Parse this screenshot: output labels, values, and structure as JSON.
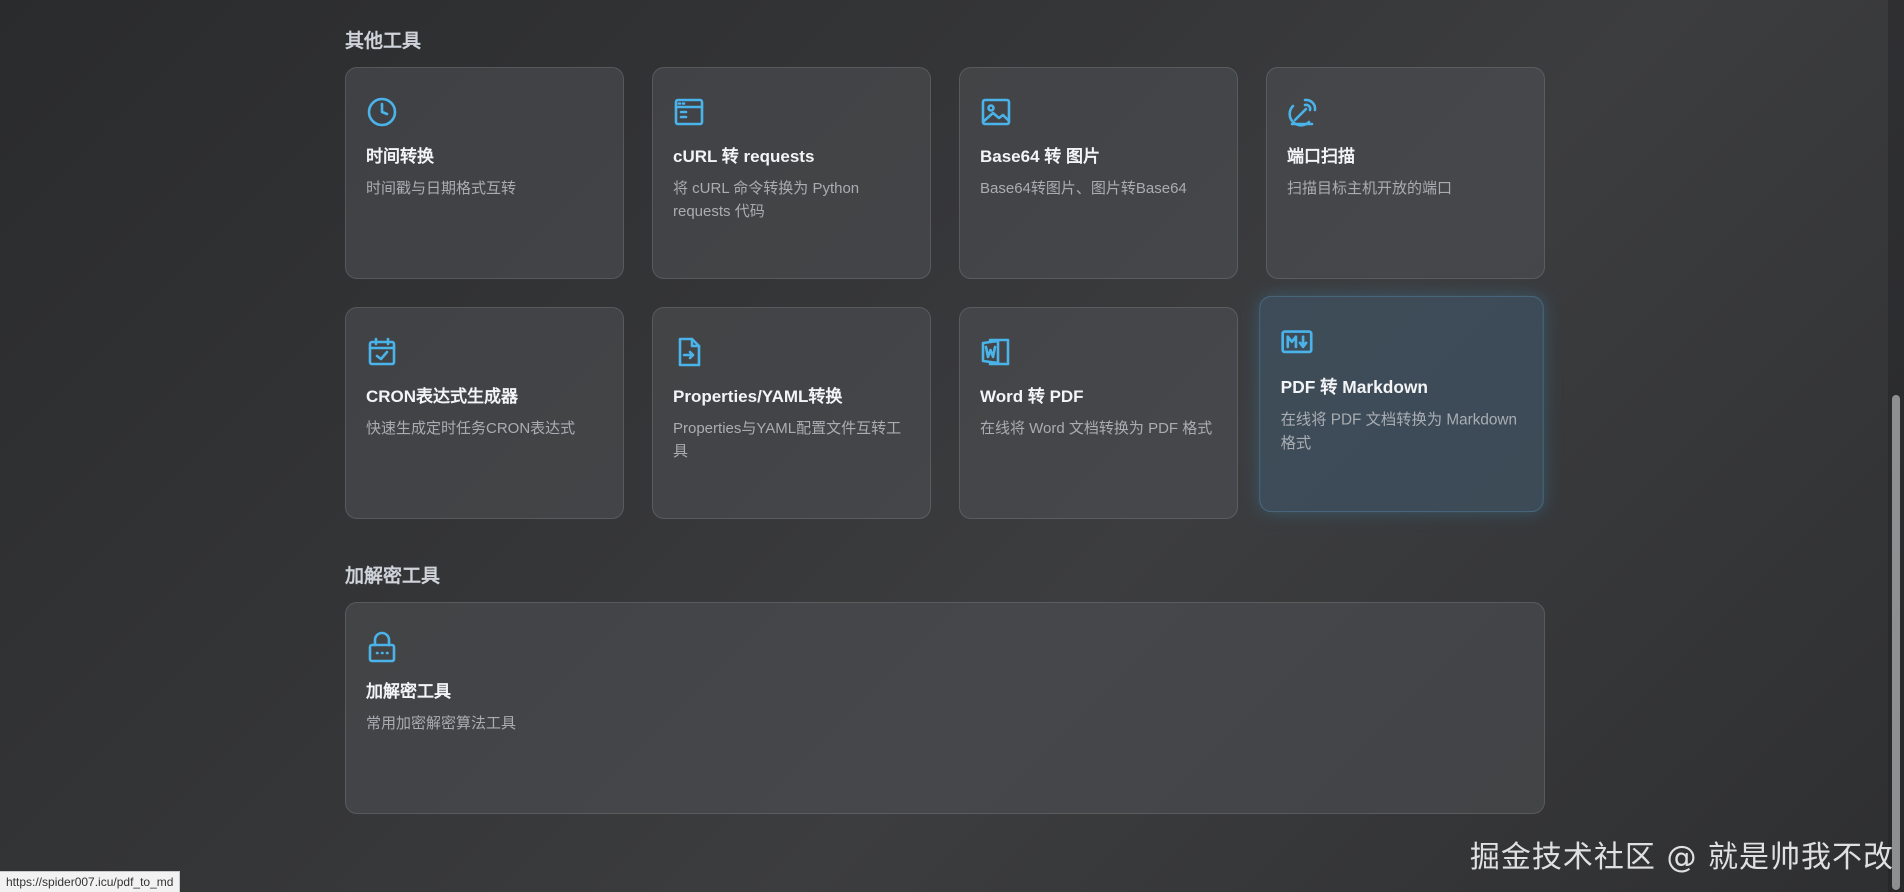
{
  "sections": {
    "other": {
      "title": "其他工具",
      "cards": [
        {
          "icon": "clock-icon",
          "title": "时间转换",
          "desc": "时间戳与日期格式互转"
        },
        {
          "icon": "browser-window-icon",
          "title": "cURL 转 requests",
          "desc": "将 cURL 命令转换为 Python requests 代码"
        },
        {
          "icon": "image-icon",
          "title": "Base64 转 图片",
          "desc": "Base64转图片、图片转Base64"
        },
        {
          "icon": "radar-icon",
          "title": "端口扫描",
          "desc": "扫描目标主机开放的端口"
        },
        {
          "icon": "calendar-check-icon",
          "title": "CRON表达式生成器",
          "desc": "快速生成定时任务CRON表达式"
        },
        {
          "icon": "file-export-icon",
          "title": "Properties/YAML转换",
          "desc": "Properties与YAML配置文件互转工具"
        },
        {
          "icon": "word-file-icon",
          "title": "Word 转 PDF",
          "desc": "在线将 Word 文档转换为 PDF 格式"
        },
        {
          "icon": "markdown-icon",
          "title": "PDF 转 Markdown",
          "desc": "在线将 PDF 文档转换为 Markdown 格式"
        }
      ]
    },
    "crypto": {
      "title": "加解密工具",
      "card": {
        "icon": "lock-icon",
        "title": "加解密工具",
        "desc": "常用加密解密算法工具"
      }
    }
  },
  "status_bar": {
    "url": "https://spider007.icu/pdf_to_md"
  },
  "watermark": "掘金技术社区 @ 就是帅我不改",
  "colors": {
    "accent": "#4ab3ea",
    "background": "#333436"
  }
}
